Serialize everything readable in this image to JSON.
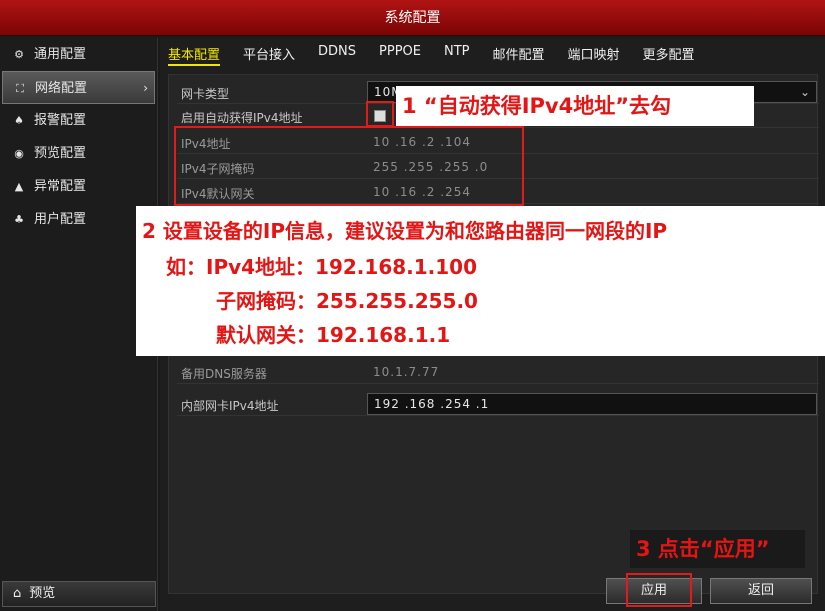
{
  "window": {
    "title": "系统配置"
  },
  "sidebar": {
    "items": [
      {
        "label": "通用配置",
        "icon": "gear-icon",
        "glyph": "⚙"
      },
      {
        "label": "网络配置",
        "icon": "network-icon",
        "glyph": "⛶",
        "arrow": "›"
      },
      {
        "label": "报警配置",
        "icon": "alarm-icon",
        "glyph": "♠"
      },
      {
        "label": "预览配置",
        "icon": "eye-icon",
        "glyph": "◉"
      },
      {
        "label": "异常配置",
        "icon": "warning-icon",
        "glyph": "▲"
      },
      {
        "label": "用户配置",
        "icon": "users-icon",
        "glyph": "♣"
      }
    ],
    "bottom": {
      "label": "预览",
      "icon": "home-icon",
      "glyph": "⌂"
    }
  },
  "tabs": [
    "基本配置",
    "平台接入",
    "DDNS",
    "PPPOE",
    "NTP",
    "邮件配置",
    "端口映射",
    "更多配置"
  ],
  "form": {
    "nic_type": {
      "label": "网卡类型",
      "value": "10M",
      "dropdown": "⌄"
    },
    "dhcp": {
      "label": "启用自动获得IPv4地址"
    },
    "ipv4_addr": {
      "label": "IPv4地址",
      "value": "10  .16  .2    .104"
    },
    "ipv4_mask": {
      "label": "IPv4子网掩码",
      "value": "255 .255 .255 .0"
    },
    "ipv4_gw": {
      "label": "IPv4默认网关",
      "value": "10  .16  .2    .254"
    },
    "dns2": {
      "label": "备用DNS服务器",
      "value": "10.1.7.77"
    },
    "lan_ipv4": {
      "label": "内部网卡IPv4地址",
      "value": "192 .168 .254 .1"
    }
  },
  "callouts": {
    "step1": "1 “自动获得IPv4地址”去勾",
    "step2_line1": "2 设置设备的IP信息，建议设置为和您路由器同一网段的IP",
    "step2_line2": "如：IPv4地址：192.168.1.100",
    "step2_line3": "子网掩码：255.255.255.0",
    "step2_line4": "默认网关：192.168.1.1",
    "step3": "3 点击“应用”"
  },
  "buttons": {
    "apply": "应用",
    "back": "返回"
  },
  "colors": {
    "accent_red": "#e41515",
    "tab_active": "#f2e600",
    "title_bar": "#9a0a0a"
  }
}
